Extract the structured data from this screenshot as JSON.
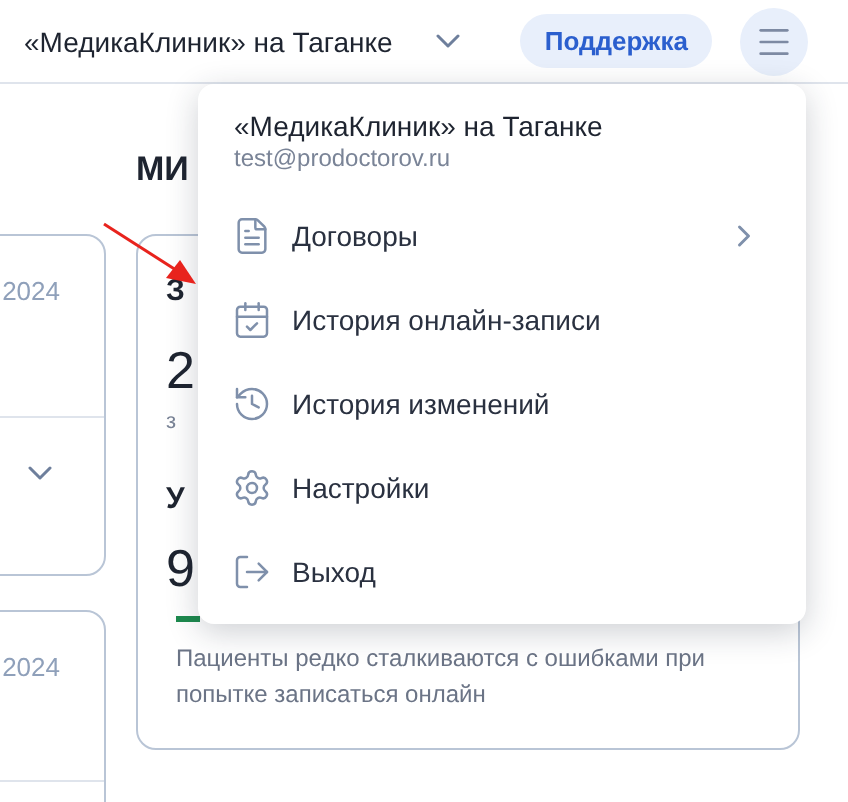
{
  "header": {
    "clinic_select": "«МедикаКлиник» на Таганке",
    "support_button": "Поддержка"
  },
  "page": {
    "section_title": "МИ",
    "left_cards": [
      {
        "date": "2024",
        "expandable": true
      },
      {
        "date": "2024",
        "expandable": false
      }
    ],
    "stat_card": {
      "heading_1": "З",
      "value_1": "2",
      "caption_1": "з",
      "heading_2": "У",
      "value_2": "9",
      "description": "Пациенты редко сталкиваются с ошибками при попытке записаться онлайн"
    }
  },
  "menu": {
    "clinic": "«МедикаКлиник» на Таганке",
    "email": "test@prodoctorov.ru",
    "items": [
      {
        "kind": "submenu",
        "label": "Договоры"
      },
      {
        "kind": "action",
        "label": "История онлайн-записи"
      },
      {
        "kind": "action",
        "label": "История изменений"
      },
      {
        "kind": "action",
        "label": "Настройки"
      },
      {
        "kind": "action",
        "label": "Выход"
      }
    ]
  }
}
